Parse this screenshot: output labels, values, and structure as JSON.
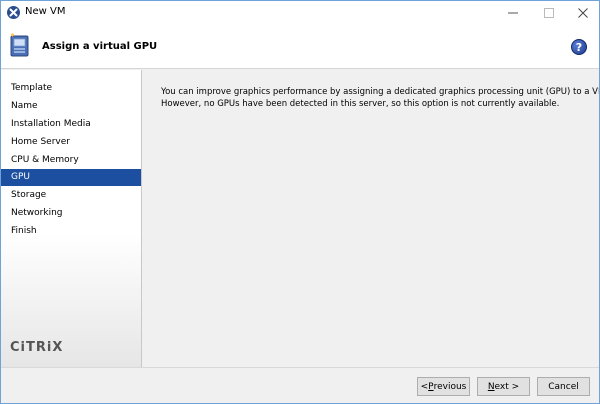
{
  "window": {
    "title": "New VM"
  },
  "header": {
    "title": "Assign a virtual GPU",
    "help_icon": "help-icon"
  },
  "sidebar": {
    "items": [
      {
        "label": "Template",
        "active": false
      },
      {
        "label": "Name",
        "active": false
      },
      {
        "label": "Installation Media",
        "active": false
      },
      {
        "label": "Home Server",
        "active": false
      },
      {
        "label": "CPU & Memory",
        "active": false
      },
      {
        "label": "GPU",
        "active": true
      },
      {
        "label": "Storage",
        "active": false
      },
      {
        "label": "Networking",
        "active": false
      },
      {
        "label": "Finish",
        "active": false
      }
    ],
    "logo": "CiTRiX"
  },
  "content": {
    "line1": "You can improve graphics performance by assigning a dedicated graphics processing unit (GPU) to a VM.",
    "line2": "However, no GPUs have been detected in this server, so this option is not currently available."
  },
  "footer": {
    "previous_prefix": "< ",
    "previous_key": "P",
    "previous_rest": "revious",
    "next_key": "N",
    "next_rest": "ext >",
    "cancel_label": "Cancel"
  },
  "colors": {
    "active_nav": "#1c4fa0",
    "window_border": "#6fa2d6",
    "background": "#f0f0f0"
  }
}
